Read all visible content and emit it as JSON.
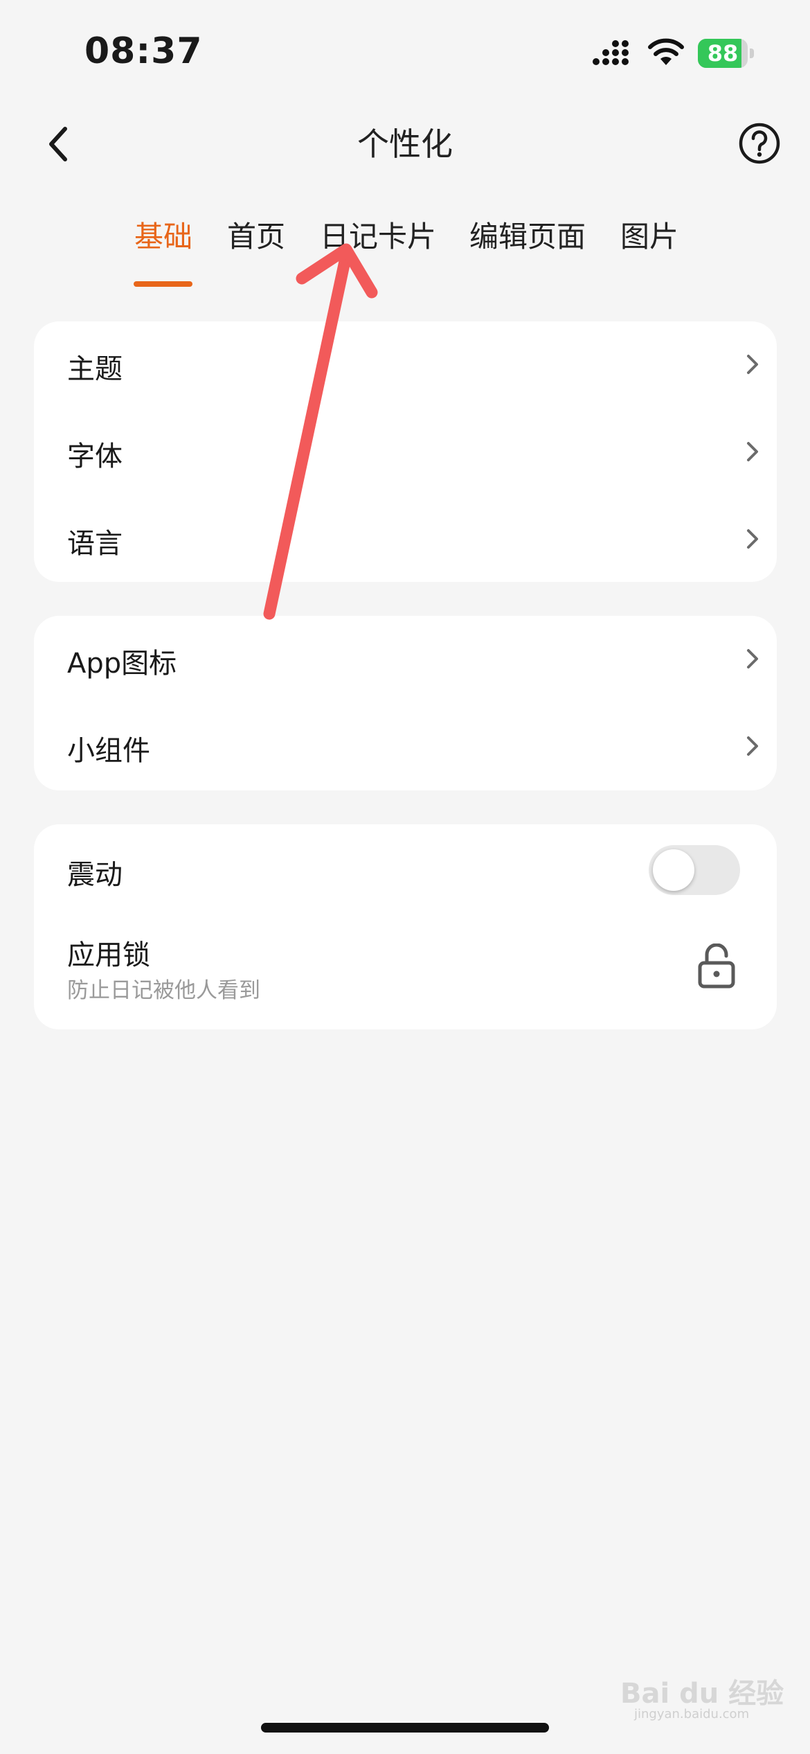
{
  "status_bar": {
    "time": "08:37",
    "battery_percent": "88",
    "battery_level": 0.88
  },
  "nav": {
    "title": "个性化",
    "back_icon": "chevron-left-icon",
    "help_icon": "question-circle-icon"
  },
  "tabs": [
    {
      "label": "基础",
      "active": true
    },
    {
      "label": "首页",
      "active": false
    },
    {
      "label": "日记卡片",
      "active": false
    },
    {
      "label": "编辑页面",
      "active": false
    },
    {
      "label": "图片",
      "active": false
    }
  ],
  "settings": {
    "group1": [
      {
        "label": "主题"
      },
      {
        "label": "字体"
      },
      {
        "label": "语言"
      }
    ],
    "group2": [
      {
        "label": "App图标"
      },
      {
        "label": "小组件"
      }
    ],
    "group3": {
      "vibration": {
        "label": "震动",
        "enabled": false
      },
      "app_lock": {
        "label": "应用锁",
        "description": "防止日记被他人看到",
        "icon": "lock-icon"
      }
    }
  },
  "watermark": {
    "text": "Bai du 经验",
    "sub": "jingyan.baidu.com"
  },
  "colors": {
    "accent": "#e8661a",
    "annotation_arrow": "#f25a5a",
    "battery": "#34c759"
  }
}
